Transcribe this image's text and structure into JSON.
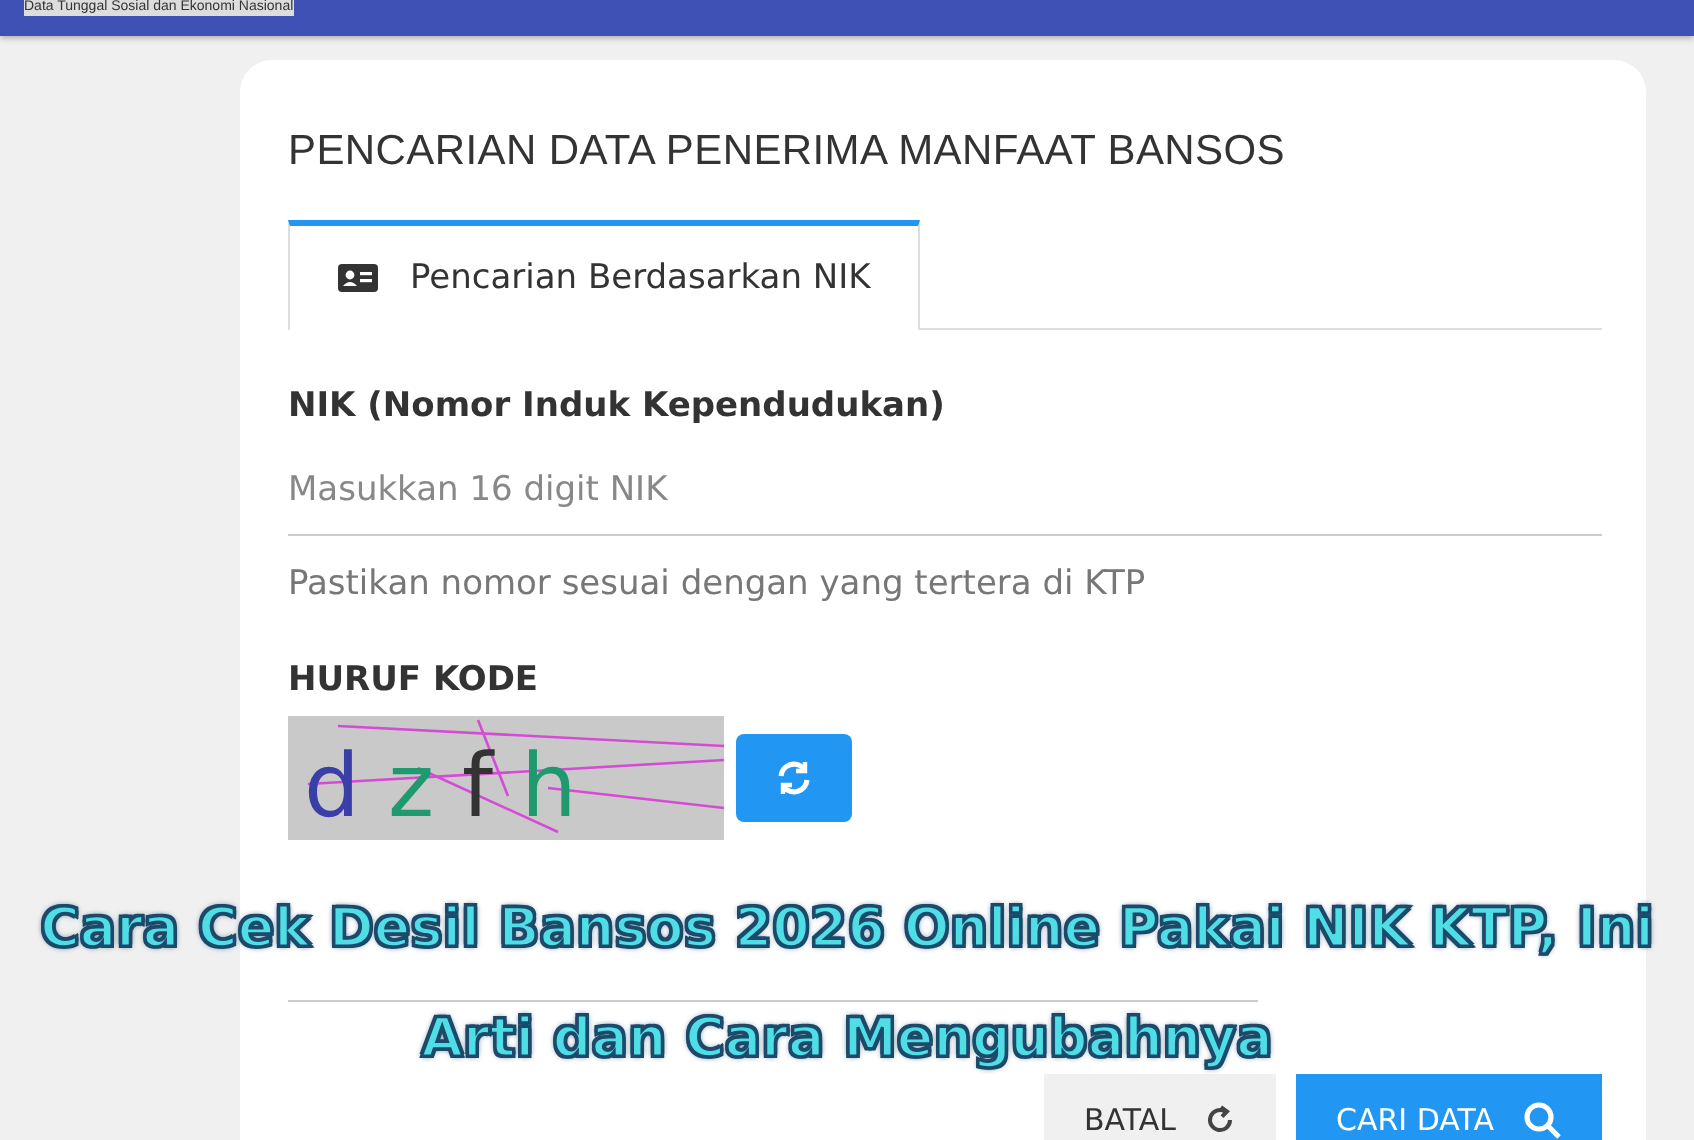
{
  "top_bar": {
    "title": "Data Tunggal Sosial dan Ekonomi Nasional"
  },
  "card": {
    "title": "PENCARIAN DATA PENERIMA MANFAAT BANSOS",
    "tabs": [
      {
        "label": "Pencarian Berdasarkan NIK",
        "selected": true
      }
    ],
    "nik": {
      "label": "NIK (Nomor Induk Kependudukan)",
      "placeholder": "Masukkan 16 digit NIK",
      "hint": "Pastikan nomor sesuai dengan yang tertera di KTP"
    },
    "captcha": {
      "label": "HURUF KODE",
      "characters": [
        {
          "char": "d",
          "color": "#3a3fa8"
        },
        {
          "char": "z",
          "color": "#1f9a6e"
        },
        {
          "char": "f",
          "color": "#333333"
        },
        {
          "char": "h",
          "color": "#1f9a6e"
        }
      ]
    },
    "buttons": [
      {
        "label": "BATAL",
        "kind": "cancel"
      },
      {
        "label": "CARI DATA",
        "kind": "search"
      }
    ]
  },
  "caption": [
    "Cara Cek Desil Bansos 2026 Online Pakai NIK KTP, Ini",
    "Arti dan Cara Mengubahnya"
  ]
}
